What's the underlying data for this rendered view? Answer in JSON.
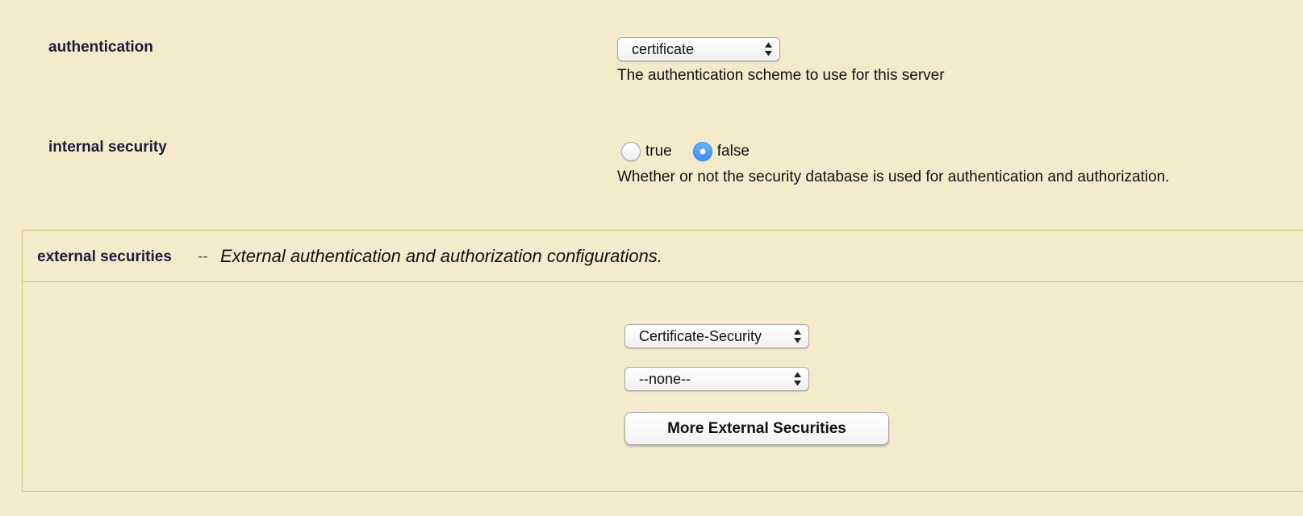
{
  "authentication": {
    "label": "authentication",
    "selected": "certificate",
    "description": "The authentication scheme to use for this server"
  },
  "internal_security": {
    "label": "internal security",
    "options": [
      {
        "label": "true",
        "checked": false
      },
      {
        "label": "false",
        "checked": true
      }
    ],
    "description": "Whether or not the security database is used for authentication and authorization."
  },
  "external_securities": {
    "title": "external securities",
    "separator": "--",
    "description": "External authentication and authorization configurations.",
    "selects": [
      {
        "selected": "Certificate-Security"
      },
      {
        "selected": "--none--"
      }
    ],
    "more_button_label": "More External Securities"
  },
  "colors": {
    "page_background": "#f3ebcb",
    "panel_border": "#d2c484",
    "radio_checked": "#3c8af2",
    "label_text": "#1c1c3a"
  },
  "icons": {
    "select_arrow": "updown-arrows-icon"
  }
}
